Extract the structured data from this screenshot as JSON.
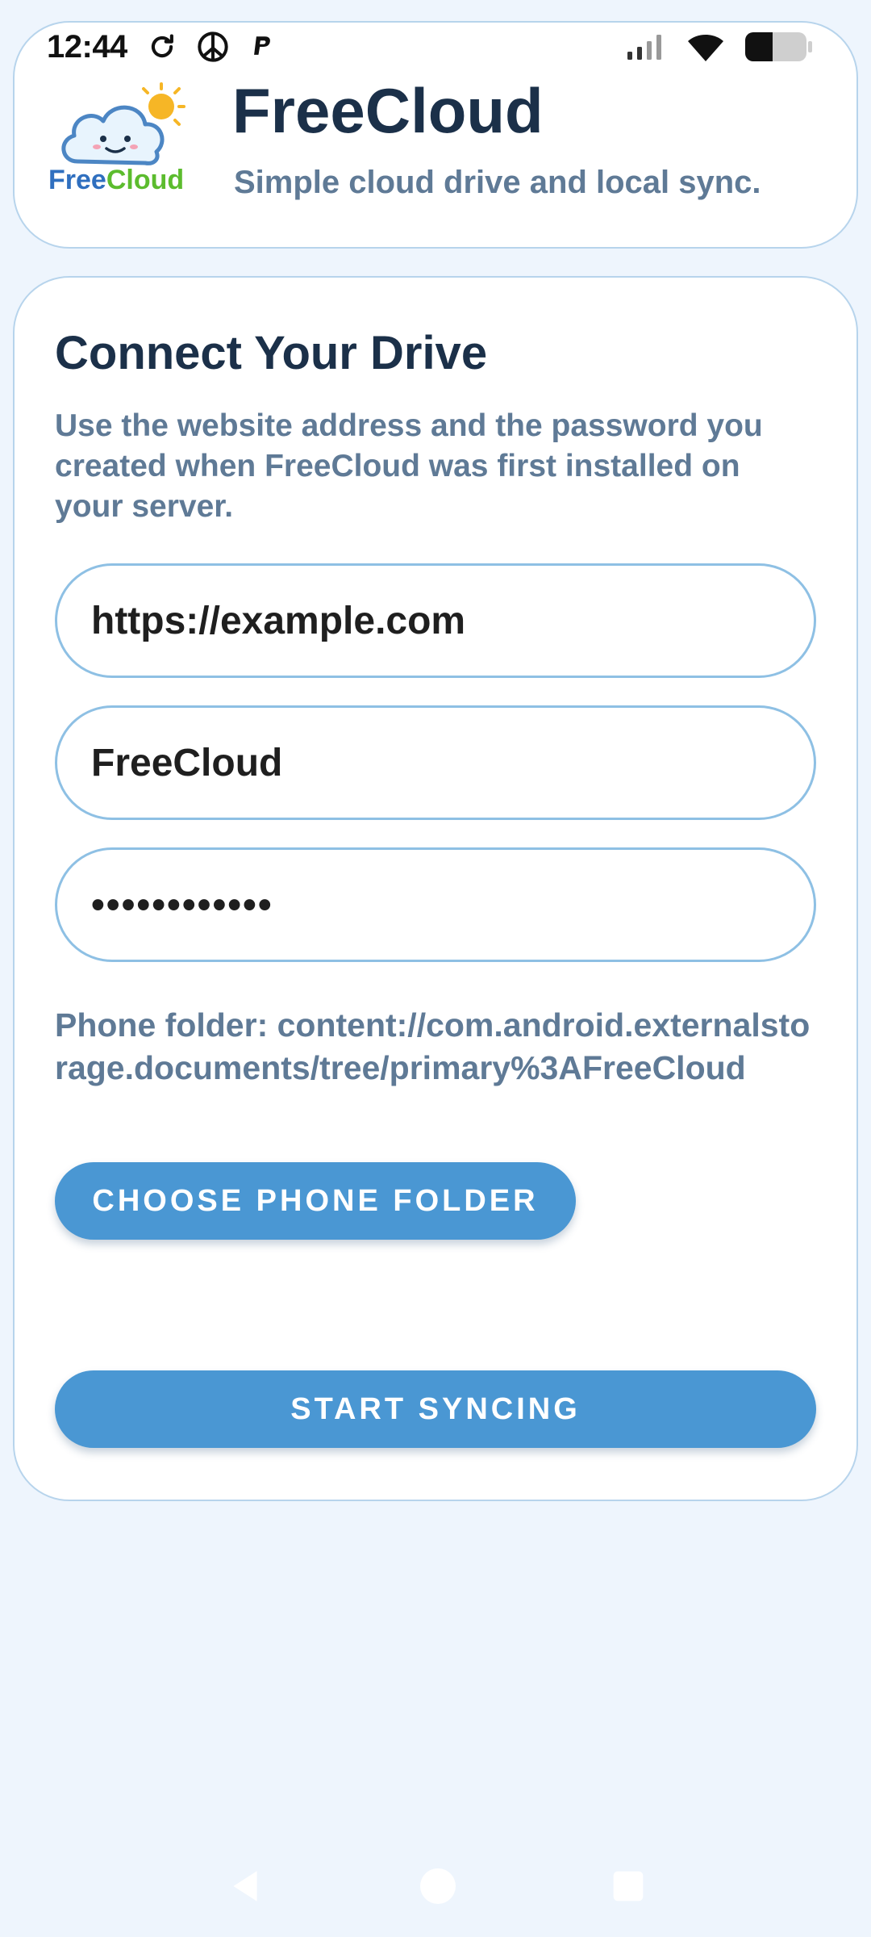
{
  "status_bar": {
    "time": "12:44",
    "left_icons": [
      "sync-icon",
      "peace-icon",
      "paypal-icon"
    ],
    "right_icons": [
      "cellular-signal-icon",
      "wifi-icon",
      "battery-icon"
    ]
  },
  "header": {
    "logo_text": "FreeCloud",
    "title": "FreeCloud",
    "subtitle": "Simple cloud drive and local sync."
  },
  "connect": {
    "title": "Connect Your Drive",
    "description": "Use the website address and the password you created when FreeCloud was first installed on your server.",
    "url_value": "https://example.com",
    "username_value": "FreeCloud",
    "password_value": "••••••••••••",
    "folder_text": "Phone folder: content://com.android.externalstorage.documents/tree/primary%3AFreeCloud",
    "choose_folder_label": "Choose Phone Folder",
    "start_label": "Start Syncing"
  },
  "nav": {
    "icons": [
      "back-icon",
      "home-icon",
      "recents-icon"
    ]
  },
  "colors": {
    "background": "#eef5fd",
    "card_border": "#b7d4ec",
    "accent": "#4a97d3",
    "title": "#1b3049",
    "muted": "#5f7a96"
  }
}
